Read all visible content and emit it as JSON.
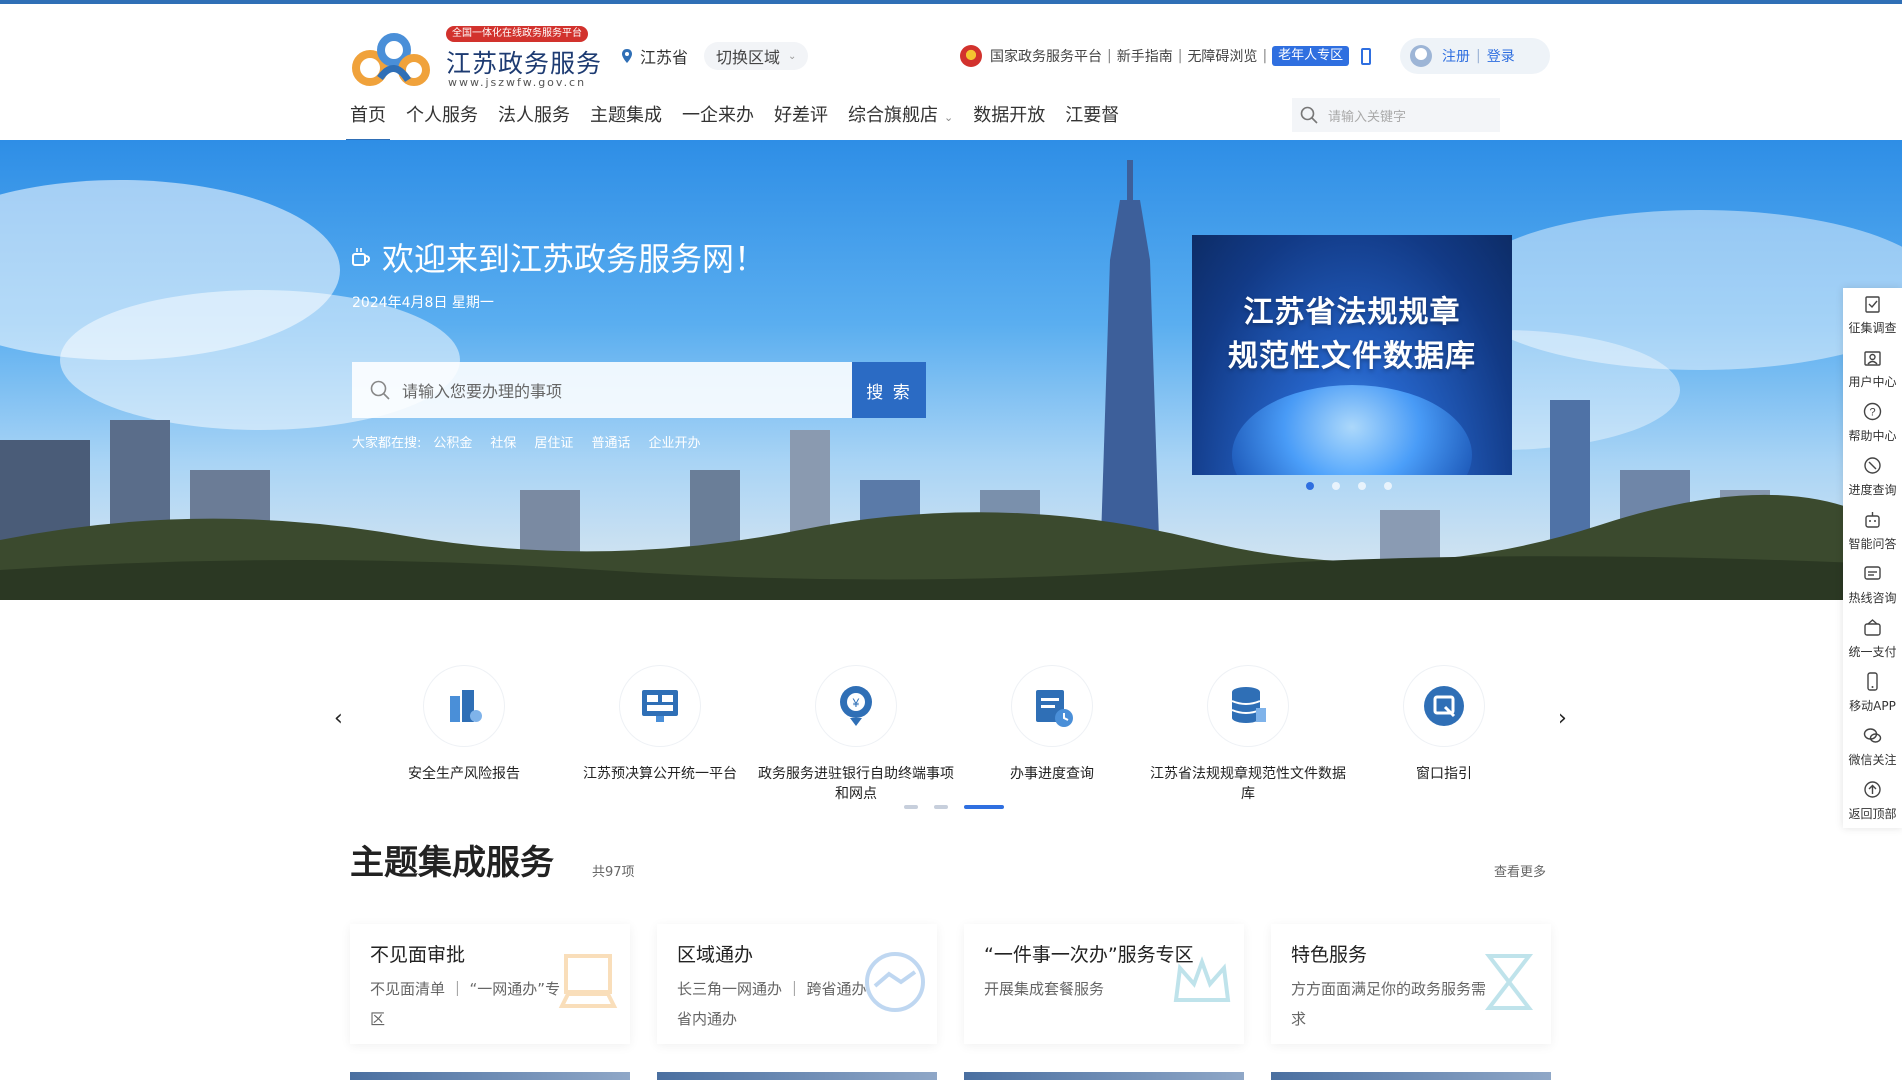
{
  "logo": {
    "badge": "全国一体化在线政务服务平台",
    "title": "江苏政务服务",
    "url": "www.jszwfw.gov.cn"
  },
  "region": {
    "current": "江苏省",
    "switch_label": "切换区域"
  },
  "top_links": {
    "national": "国家政务服务平台",
    "guide": "新手指南",
    "accessible": "无障碍浏览",
    "elder": "老年人专区",
    "register": "注册",
    "login": "登录"
  },
  "nav": {
    "items": [
      "首页",
      "个人服务",
      "法人服务",
      "主题集成",
      "一企来办",
      "好差评",
      "综合旗舰店",
      "数据开放",
      "江要督"
    ],
    "search_placeholder": "请输入关键字"
  },
  "banner": {
    "welcome": "欢迎来到江苏政务服务网！",
    "date": "2024年4月8日 星期一",
    "search_placeholder": "请输入您要办理的事项",
    "search_button": "搜 索",
    "hot_label": "大家都在搜:",
    "hot_items": [
      "公积金",
      "社保",
      "居住证",
      "普通话",
      "企业开办"
    ],
    "promo_line1": "江苏省法规规章",
    "promo_line2": "规范性文件数据库"
  },
  "sidebar": {
    "items": [
      "征集调查",
      "用户中心",
      "帮助中心",
      "进度查询",
      "智能问答",
      "热线咨询",
      "统一支付",
      "移动APP",
      "微信关注",
      "返回顶部"
    ]
  },
  "quick_services": [
    {
      "label": "安全生产风险报告"
    },
    {
      "label": "江苏预决算公开统一平台"
    },
    {
      "label": "政务服务进驻银行自助终端事项和网点"
    },
    {
      "label": "办事进度查询"
    },
    {
      "label": "江苏省法规规章规范性文件数据库"
    },
    {
      "label": "窗口指引"
    }
  ],
  "theme": {
    "title": "主题集成服务",
    "count": "共97项",
    "more": "查看更多",
    "cards": [
      {
        "title": "不见面审批",
        "desc": "不见面清单 ｜ “一网通办”专区"
      },
      {
        "title": "区域通办",
        "desc": "长三角一网通办 ｜ 跨省通办 省内通办"
      },
      {
        "title": "“一件事一次办”服务专区",
        "desc": "开展集成套餐服务"
      },
      {
        "title": "特色服务",
        "desc": "方方面面满足你的政务服务需求"
      }
    ]
  },
  "colors": {
    "brand": "#2f6fb6",
    "accent": "#2f6fe0",
    "badge_red": "#d2322d"
  }
}
